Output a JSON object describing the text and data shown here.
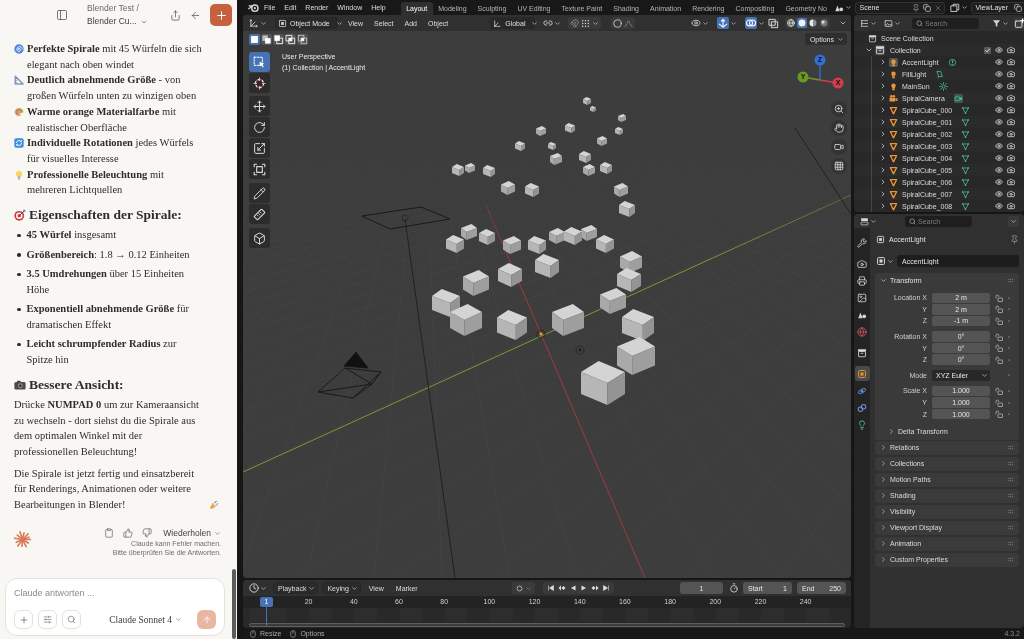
{
  "chat": {
    "header": {
      "title": "Blender Test /",
      "subtitle": "Blender Cu..."
    },
    "highlights": [
      "**Perfekte Spirale** mit 45 Würfeln die sich elegant nach oben windet",
      "**Deutlich abnehmende Größe** - von großen Würfeln unten zu winzigen oben",
      "**Warme orange Materialfarbe** mit realistischer Oberfläche",
      "**Individuelle Rotationen** jedes Würfels für visuelles Interesse",
      "**Professionelle Beleuchtung** mit mehreren Lichtquellen"
    ],
    "properties_heading": "Eigenschaften der Spirale:",
    "properties": [
      "**45 Würfel** insgesamt",
      "**Größenbereich**: 1.8 → 0.12 Einheiten",
      "**3.5 Umdrehungen** über 15 Einheiten Höhe",
      "**Exponentiell abnehmende Größe** für dramatischen Effekt",
      "**Leicht schrumpfender Radius** zur Spitze hin"
    ],
    "view_heading": "Bessere Ansicht:",
    "paragraphs": [
      "Drücke **NUMPAD 0** um zur Kameraansicht zu wechseln - dort siehst du die Spirale aus dem optimalen Winkel mit der professionellen Beleuchtung!",
      "Die Spirale ist jetzt fertig und einsatzbereit für Renderings, Animationen oder weitere Bearbeitungen in Blender!"
    ],
    "retry": "Wiederholen",
    "disclaimer": [
      "Claude kann Fehler machen.",
      "Bitte überprüfen Sie die Antworten."
    ],
    "composer": {
      "placeholder": "Claude antworten ...",
      "model": "Claude Sonnet 4"
    }
  },
  "blender": {
    "menus": [
      "File",
      "Edit",
      "Render",
      "Window",
      "Help"
    ],
    "workspaces": [
      {
        "label": "Layout",
        "selected": true
      },
      {
        "label": "Modeling",
        "selected": false
      },
      {
        "label": "Sculpting",
        "selected": false
      },
      {
        "label": "UV Editing",
        "selected": false
      },
      {
        "label": "Texture Paint",
        "selected": false
      },
      {
        "label": "Shading",
        "selected": false
      },
      {
        "label": "Animation",
        "selected": false
      },
      {
        "label": "Rendering",
        "selected": false
      },
      {
        "label": "Compositing",
        "selected": false
      },
      {
        "label": "Geometry No",
        "selected": false
      }
    ],
    "scene": "Scene",
    "view_layer": "ViewLayer",
    "viewport": {
      "mode": "Object Mode",
      "menus": [
        "View",
        "Select",
        "Add",
        "Object"
      ],
      "orientation": "Global",
      "snapping": false,
      "proportional_editing": false,
      "show_gizmo": true,
      "show_overlays": true,
      "shading": [
        {
          "selected": false
        },
        {
          "selected": true
        },
        {
          "selected": false
        },
        {
          "selected": false
        }
      ],
      "select_modes": [
        {
          "selected": true
        },
        {
          "selected": false
        },
        {
          "selected": false
        },
        {
          "selected": false
        },
        {
          "selected": false
        }
      ],
      "options": "Options",
      "info": [
        "User Perspective",
        "(1) Collection | AccentLight"
      ],
      "tools": [
        {
          "selected": true
        },
        {
          "selected": false
        },
        {
          "selected": false
        },
        {
          "selected": false
        },
        {
          "selected": false
        },
        {
          "selected": false
        },
        {
          "selected": false
        },
        {
          "selected": false
        },
        {
          "selected": false
        }
      ],
      "axes": [
        {
          "label": "Z",
          "color": "#2f6fd6"
        },
        {
          "label": "Y",
          "color": "#6a9a23"
        },
        {
          "label": "X",
          "color": "#d23c4b"
        }
      ]
    },
    "timeline": {
      "menus": [
        {
          "label": "Playback",
          "kind": "dropdown"
        },
        {
          "label": "Keying",
          "kind": "dropdown"
        },
        {
          "label": "View",
          "kind": "menu"
        },
        {
          "label": "Marker",
          "kind": "menu"
        }
      ],
      "frame": "1",
      "start_label": "Start",
      "start": "1",
      "end_label": "End",
      "end": "250",
      "playhead": "1",
      "ruler": [
        "20",
        "40",
        "60",
        "80",
        "100",
        "120",
        "140",
        "160",
        "180",
        "200",
        "220",
        "240"
      ]
    },
    "outliner": {
      "search_placeholder": "Search",
      "root": "Scene Collection",
      "collection": {
        "label": "Collection",
        "expanded": true,
        "checked": true,
        "children": [
          {
            "label": "AccentLight",
            "kind": "spot_light",
            "expanded": false,
            "selected": true
          },
          {
            "label": "FillLight",
            "kind": "area_light",
            "expanded": false,
            "selected": false
          },
          {
            "label": "MainSun",
            "kind": "sun_light",
            "expanded": false,
            "selected": false
          },
          {
            "label": "SpiralCamera",
            "kind": "camera",
            "expanded": false,
            "selected": false
          },
          {
            "label": "SpiralCube_000",
            "kind": "mesh",
            "expanded": false,
            "selected": false
          },
          {
            "label": "SpiralCube_001",
            "kind": "mesh",
            "expanded": false,
            "selected": false
          },
          {
            "label": "SpiralCube_002",
            "kind": "mesh",
            "expanded": false,
            "selected": false
          },
          {
            "label": "SpiralCube_003",
            "kind": "mesh",
            "expanded": false,
            "selected": false
          },
          {
            "label": "SpiralCube_004",
            "kind": "mesh",
            "expanded": false,
            "selected": false
          },
          {
            "label": "SpiralCube_005",
            "kind": "mesh",
            "expanded": false,
            "selected": false
          },
          {
            "label": "SpiralCube_006",
            "kind": "mesh",
            "expanded": false,
            "selected": false
          },
          {
            "label": "SpiralCube_007",
            "kind": "mesh",
            "expanded": false,
            "selected": false
          },
          {
            "label": "SpiralCube_008",
            "kind": "mesh",
            "expanded": false,
            "selected": false
          }
        ]
      }
    },
    "properties": {
      "search_placeholder": "Search",
      "tabs": [
        {
          "selected": false
        },
        {
          "selected": false
        },
        {
          "selected": false
        },
        {
          "selected": false
        },
        {
          "selected": false
        },
        {
          "selected": false
        },
        {
          "selected": false
        },
        {
          "selected": true
        },
        {
          "selected": false
        },
        {
          "selected": false
        },
        {
          "selected": false
        }
      ],
      "object": "AccentLight",
      "name_field": "AccentLight",
      "transform": {
        "title": "Transform",
        "expanded": true,
        "groups": [
          [
            {
              "label": "Location X",
              "value": "2 m",
              "kind": "number"
            },
            {
              "label": "Y",
              "value": "2 m",
              "kind": "number"
            },
            {
              "label": "Z",
              "value": "-1 m",
              "kind": "number"
            }
          ],
          [
            {
              "label": "Rotation X",
              "value": "0°",
              "kind": "number"
            },
            {
              "label": "Y",
              "value": "0°",
              "kind": "number"
            },
            {
              "label": "Z",
              "value": "0°",
              "kind": "number"
            }
          ],
          [
            {
              "label": "Mode",
              "value": "XYZ Euler",
              "kind": "dropdown"
            }
          ],
          [
            {
              "label": "Scale X",
              "value": "1.000",
              "kind": "number"
            },
            {
              "label": "Y",
              "value": "1.000",
              "kind": "number"
            },
            {
              "label": "Z",
              "value": "1.000",
              "kind": "number"
            }
          ]
        ],
        "subpanel": {
          "label": "Delta Transform",
          "expanded": false
        }
      },
      "panels": [
        {
          "label": "Relations",
          "expanded": false
        },
        {
          "label": "Collections",
          "expanded": false
        },
        {
          "label": "Motion Paths",
          "expanded": false
        },
        {
          "label": "Shading",
          "expanded": false
        },
        {
          "label": "Visibility",
          "expanded": false
        },
        {
          "label": "Viewport Display",
          "expanded": false
        },
        {
          "label": "Animation",
          "expanded": false
        },
        {
          "label": "Custom Properties",
          "expanded": false
        }
      ]
    },
    "status": {
      "items": [
        "Resize",
        "Options"
      ],
      "version": "4.3.2"
    }
  }
}
